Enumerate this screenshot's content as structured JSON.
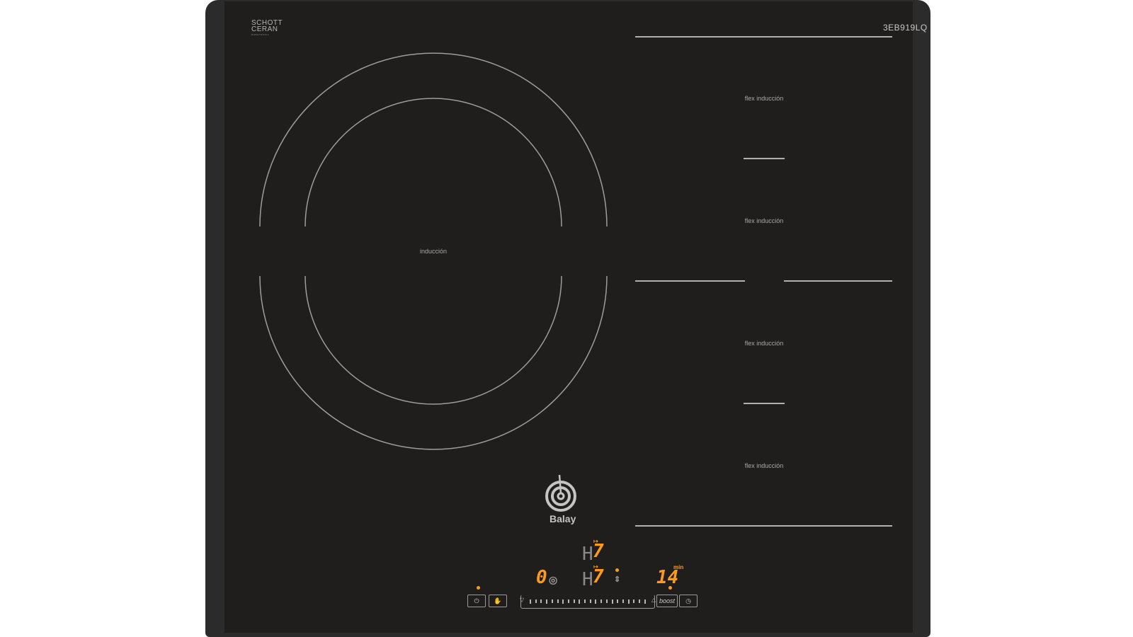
{
  "brand": {
    "mark_line1": "SCHOTT",
    "mark_line2": "CERAN",
    "mark_small": "ROBOTRONIC"
  },
  "model": "3EB919LQ",
  "zones": {
    "main_label": "inducción",
    "flex_labels": [
      "flex inducción",
      "flex inducción",
      "flex inducción",
      "flex inducción"
    ]
  },
  "logo_text": "Balay",
  "display": {
    "main_power": "0",
    "flex_top_prefix": "H",
    "flex_top_value": "7",
    "flex_bottom_prefix": "H",
    "flex_bottom_value": "7",
    "timer_value": "14",
    "timer_unit": "min"
  },
  "controls": {
    "boost_label": "boost"
  },
  "colors": {
    "glass": "#1f1e1d",
    "frame": "#2b2b2b",
    "display_amber": "#ff9a1a",
    "print": "#a8a8a8"
  }
}
